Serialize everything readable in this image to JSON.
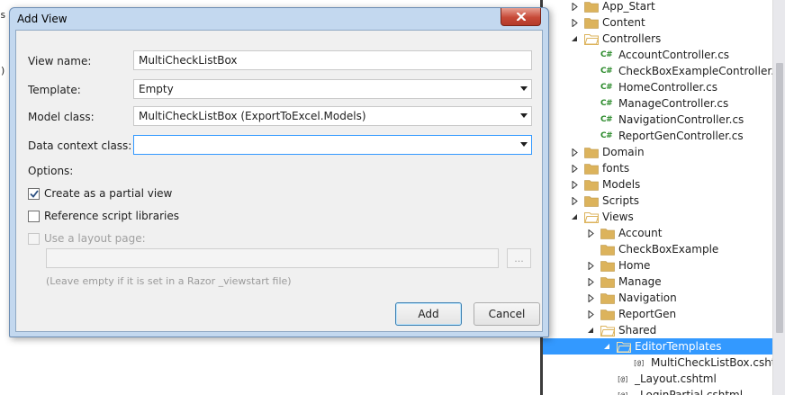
{
  "editor": {
    "ghost_chars": [
      "s",
      "",
      ")"
    ]
  },
  "dialog": {
    "title": "Add View",
    "fields": {
      "view_name": {
        "label": "View name:",
        "value": "MultiCheckListBox"
      },
      "template": {
        "label": "Template:",
        "value": "Empty"
      },
      "model_class": {
        "label": "Model class:",
        "value": "MultiCheckListBox (ExportToExcel.Models)"
      },
      "data_context_class": {
        "label": "Data context class:",
        "value": ""
      }
    },
    "options_label": "Options:",
    "options": {
      "partial_view": {
        "label": "Create as a partial view",
        "checked": true
      },
      "script_libraries": {
        "label": "Reference script libraries",
        "checked": false
      },
      "layout_page": {
        "label": "Use a layout page:",
        "checked": false,
        "disabled": true
      }
    },
    "layout_path_value": "",
    "browse_label": "...",
    "layout_hint": "(Leave empty if it is set in a Razor _viewstart file)",
    "add_label": "Add",
    "cancel_label": "Cancel"
  },
  "solution_explorer": {
    "items": [
      {
        "label": "App_Start",
        "type": "folder",
        "expanded": false
      },
      {
        "label": "Content",
        "type": "folder",
        "expanded": false
      },
      {
        "label": "Controllers",
        "type": "folder",
        "expanded": true
      },
      {
        "label": "AccountController.cs",
        "type": "cs"
      },
      {
        "label": "CheckBoxExampleController.cs",
        "type": "cs"
      },
      {
        "label": "HomeController.cs",
        "type": "cs"
      },
      {
        "label": "ManageController.cs",
        "type": "cs"
      },
      {
        "label": "NavigationController.cs",
        "type": "cs"
      },
      {
        "label": "ReportGenController.cs",
        "type": "cs"
      },
      {
        "label": "Domain",
        "type": "folder",
        "expanded": false
      },
      {
        "label": "fonts",
        "type": "folder",
        "expanded": false
      },
      {
        "label": "Models",
        "type": "folder",
        "expanded": false
      },
      {
        "label": "Scripts",
        "type": "folder",
        "expanded": false
      },
      {
        "label": "Views",
        "type": "folder",
        "expanded": true
      },
      {
        "label": "Account",
        "type": "folder",
        "expanded": false
      },
      {
        "label": "CheckBoxExample",
        "type": "folder"
      },
      {
        "label": "Home",
        "type": "folder",
        "expanded": false
      },
      {
        "label": "Manage",
        "type": "folder",
        "expanded": false
      },
      {
        "label": "Navigation",
        "type": "folder",
        "expanded": false
      },
      {
        "label": "ReportGen",
        "type": "folder",
        "expanded": false
      },
      {
        "label": "Shared",
        "type": "folder",
        "expanded": true
      },
      {
        "label": "EditorTemplates",
        "type": "folder",
        "expanded": true,
        "selected": true
      },
      {
        "label": "MultiCheckListBox.cshtml",
        "type": "cshtml"
      },
      {
        "label": "_Layout.cshtml",
        "type": "cshtml"
      },
      {
        "label": "_LoginPartial.cshtml",
        "type": "cshtml"
      }
    ],
    "cs_icon_text": "C#",
    "cshtml_icon_text": "[@]"
  },
  "colors": {
    "selection": "#3399ff",
    "folder": "#dcb35c",
    "cs_icon": "#2a8a2a",
    "dialog_frame": "#c3d8ef",
    "close_button": "#c74a38"
  }
}
